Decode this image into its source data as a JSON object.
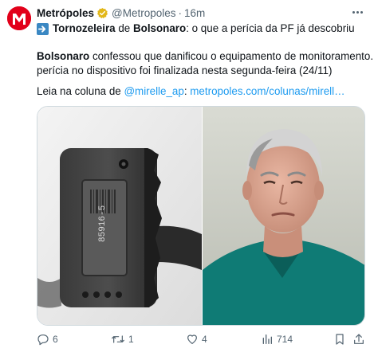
{
  "author": {
    "display_name": "Metrópoles",
    "handle": "@Metropoles",
    "separator": "·",
    "time": "16m",
    "avatar_icon": "metropoles-logo-icon",
    "verified_icon": "verified-gold-badge-icon",
    "brand_color": "#e2001a"
  },
  "tweet": {
    "headline_prefix": "Tornozeleira",
    "headline_mid": " de ",
    "headline_name": "Bolsonaro",
    "headline_rest": ": o que a perícia da PF já descobriu",
    "arrow_icon": "right-arrow-emoji-icon",
    "body_bold": "Bolsonaro",
    "body_line1_rest": " confessou que danificou o equipamento de monitoramento. A",
    "body_line2": "perícia no dispositivo foi finalizada nesta segunda-feira (24/11)",
    "read_prefix": "Leia na coluna de ",
    "mention": "@mirelle_ap",
    "mention_sep": ": ",
    "url": "metropoles.com/colunas/mirell…",
    "link_color": "#1d9bf0"
  },
  "media": {
    "left_image": "ankle-monitor-photo",
    "right_image": "bolsonaro-portrait-photo",
    "device_label": "85916-5"
  },
  "actions": {
    "replies": "6",
    "reposts": "1",
    "likes": "4",
    "views": "714",
    "reply_icon": "reply-icon",
    "repost_icon": "repost-icon",
    "like_icon": "heart-icon",
    "views_icon": "views-bar-chart-icon",
    "bookmark_icon": "bookmark-icon",
    "share_icon": "share-icon"
  }
}
